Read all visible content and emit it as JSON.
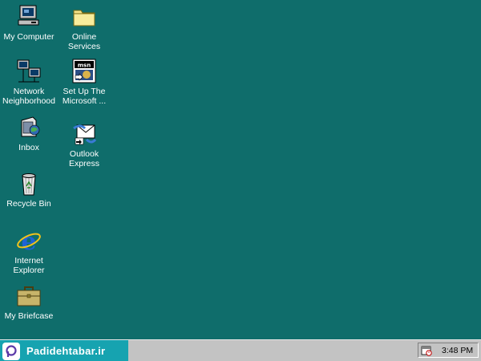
{
  "desktop": {
    "background": "#0f6d6b",
    "icons": [
      {
        "id": "my-computer",
        "label": "My Computer",
        "icon": "computer-icon"
      },
      {
        "id": "online-services",
        "label": "Online\nServices",
        "icon": "folder-icon"
      },
      {
        "id": "network-neighborhood",
        "label": "Network\nNeighborhood",
        "icon": "network-icon"
      },
      {
        "id": "setup-msn",
        "label": "Set Up The\nMicrosoft ...",
        "icon": "msn-setup-icon"
      },
      {
        "id": "inbox",
        "label": "Inbox",
        "icon": "inbox-icon"
      },
      {
        "id": "outlook-express",
        "label": "Outlook\nExpress",
        "icon": "outlook-express-icon"
      },
      {
        "id": "recycle-bin",
        "label": "Recycle Bin",
        "icon": "recycle-bin-icon"
      },
      {
        "id": "internet-explorer",
        "label": "Internet\nExplorer",
        "icon": "internet-explorer-icon"
      },
      {
        "id": "my-briefcase",
        "label": "My Briefcase",
        "icon": "briefcase-icon"
      }
    ]
  },
  "taskbar": {
    "brand_text": "Padidehtabar.ir",
    "brand_color": "#16a3b0",
    "tray_icon": "scheduler-icon",
    "clock": "3:48 PM"
  }
}
